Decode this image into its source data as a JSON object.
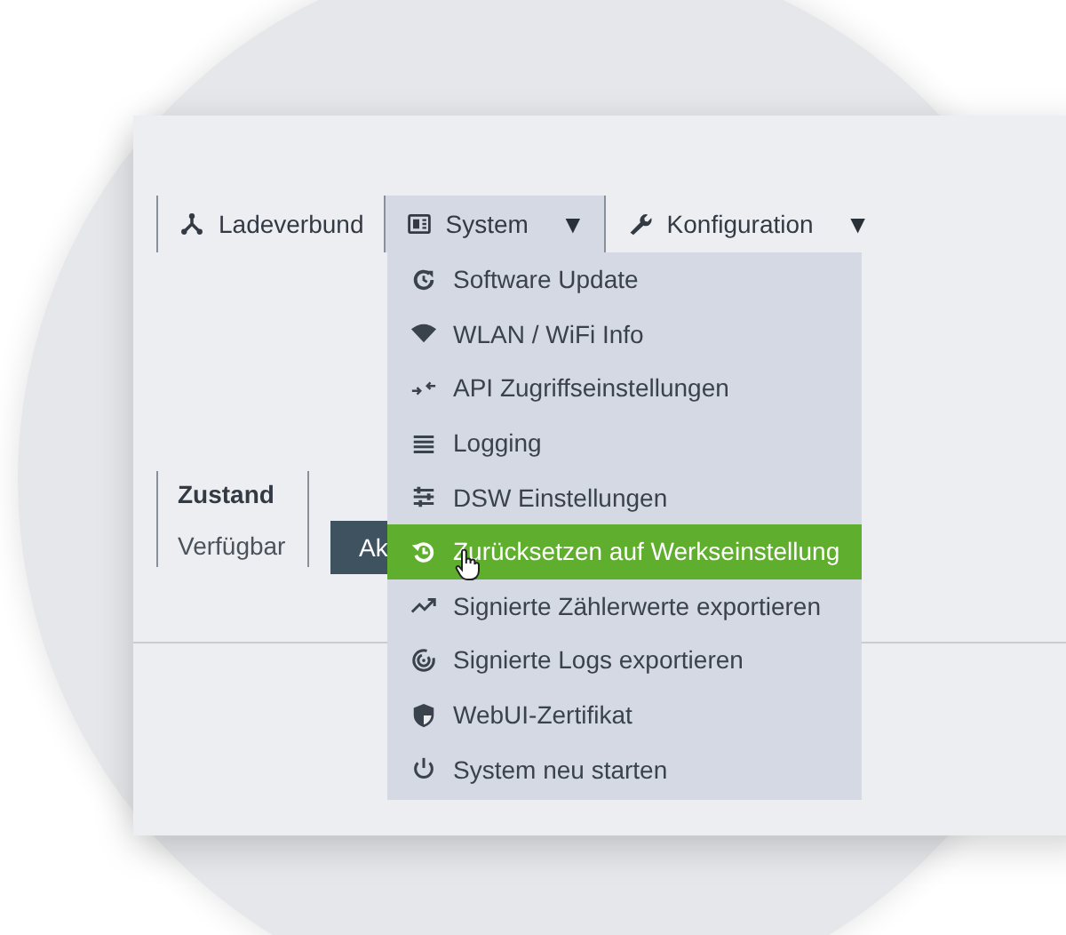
{
  "nav": [
    {
      "label": "Ladeverbund",
      "selected": false
    },
    {
      "label": "System",
      "caret": "▼",
      "selected": true
    },
    {
      "label": "Konfiguration",
      "caret": "▼",
      "selected": false
    }
  ],
  "status": {
    "heading": "Zustand",
    "value": "Verfügbar"
  },
  "action_button": {
    "label": "Ak"
  },
  "menu": {
    "items": [
      {
        "label": "Software Update",
        "selected": false
      },
      {
        "label": "WLAN / WiFi Info",
        "selected": false
      },
      {
        "label": "API Zugriffseinstellungen",
        "selected": false
      },
      {
        "label": "Logging",
        "selected": false
      },
      {
        "label": "DSW Einstellungen",
        "selected": false
      },
      {
        "label": "Zurücksetzen auf Werkseinstellung",
        "selected": true
      },
      {
        "label": "Signierte Zählerwerte exportieren",
        "selected": false
      },
      {
        "label": "Signierte Logs exportieren",
        "selected": false
      },
      {
        "label": "WebUI-Zertifikat",
        "selected": false
      },
      {
        "label": "System neu starten",
        "selected": false
      }
    ]
  }
}
